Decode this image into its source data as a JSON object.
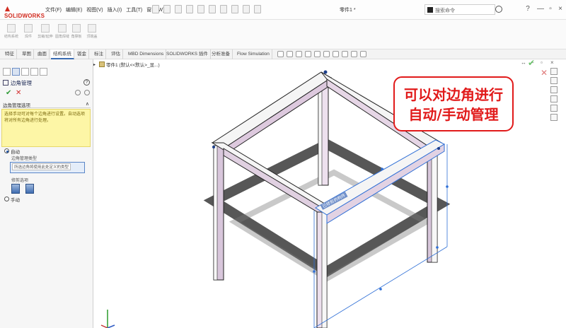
{
  "app": {
    "logo_text": "SOLIDWORKS",
    "menus": [
      "文件(F)",
      "编辑(E)",
      "视图(V)",
      "插入(I)",
      "工具(T)",
      "窗口(W)"
    ],
    "document_title": "零件1 *",
    "search_placeholder": "搜索命令",
    "window_controls": [
      "—",
      "▫",
      "×"
    ]
  },
  "command_manager": {
    "buttons": [
      "结构系统",
      "焊件",
      "剪裁/延伸",
      "圆角焊缝",
      "角撑板",
      "顶端盖"
    ]
  },
  "tabs": [
    {
      "label": "特征"
    },
    {
      "label": "草图"
    },
    {
      "label": "曲面"
    },
    {
      "label": "结构系统",
      "active": true
    },
    {
      "label": "钣金"
    },
    {
      "label": "标注"
    },
    {
      "label": "评估"
    },
    {
      "label": "MBD Dimensions"
    },
    {
      "label": "SOLIDWORKS 插件"
    },
    {
      "label": "分析准备"
    },
    {
      "label": "Flow Simulation"
    }
  ],
  "property_manager": {
    "title": "边角管理",
    "group_header": "边角管理选项",
    "message": "选择手动可对每个边角进行设置。自动选项将对所有边角进行处理。",
    "options": {
      "auto_label": "自动",
      "manual_label": "手动",
      "selected": "auto"
    },
    "sublist_label": "边角管理类型",
    "list_value": "所选边角将使用此处定义的类型",
    "trim_label": "修剪选项"
  },
  "feature_tree": {
    "node_label": "零件1 (默认<<默认>_显...)"
  },
  "annotation": {
    "line1": "可以对边角进行",
    "line2": "自动/手动管理",
    "color": "#e11a1a"
  },
  "model_label": "已修剪的构件",
  "colors": {
    "member_face": "#e6d6e6",
    "member_edge": "#222222",
    "selection": "#2f6fd6"
  }
}
